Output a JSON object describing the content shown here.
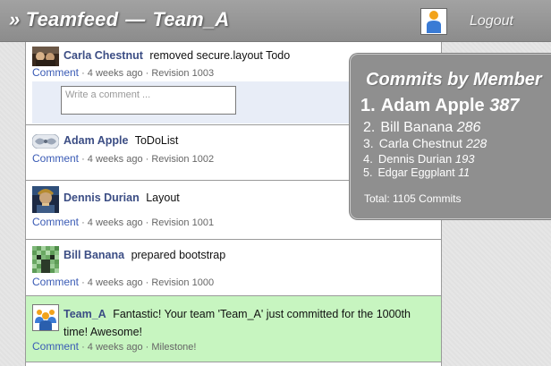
{
  "header": {
    "app_name": "» Teamfeed",
    "separator": "—",
    "team_name": "Team_A",
    "logout_label": "Logout"
  },
  "feed": {
    "comment_label": "Comment",
    "items": [
      {
        "author": "Carla Chestnut",
        "message": "removed secure.layout Todo",
        "time": "· 4 weeks ago",
        "detail": "· Revision 1003",
        "comment_placeholder": "Write a comment ..."
      },
      {
        "author": "Adam Apple",
        "message": "ToDoList",
        "time": "· 4 weeks ago",
        "detail": "· Revision 1002"
      },
      {
        "author": "Dennis Durian",
        "message": "Layout",
        "time": "· 4 weeks ago",
        "detail": "· Revision 1001"
      },
      {
        "author": "Bill Banana",
        "message": "prepared bootstrap",
        "time": "· 4 weeks ago",
        "detail": "· Revision 1000"
      },
      {
        "author": "Team_A",
        "message": "Fantastic! Your team 'Team_A' just committed for the 1000th time! Awesome!",
        "time": "· 4 weeks ago",
        "detail": "· Milestone!"
      }
    ]
  },
  "stats": {
    "title": "Commits by Member",
    "members": [
      {
        "rank": "1.",
        "name": "Adam Apple",
        "commits": "387"
      },
      {
        "rank": "2.",
        "name": "Bill Banana",
        "commits": "286"
      },
      {
        "rank": "3.",
        "name": "Carla Chestnut",
        "commits": "228"
      },
      {
        "rank": "4.",
        "name": "Dennis Durian",
        "commits": "193"
      },
      {
        "rank": "5.",
        "name": "Edgar Eggplant",
        "commits": "11"
      }
    ],
    "total": "Total: 1105 Commits"
  },
  "colors": {
    "header_bg": "#999999",
    "author_link": "#3b4d84",
    "comment_link": "#3a5bb5",
    "milestone_bg": "#c7f5c0",
    "stats_bg": "#8f8f8f"
  },
  "icons": {
    "user_avatar": "user-silhouette-icon",
    "carla_avatar": "carla-chestnut-avatar",
    "adam_avatar": "adam-apple-avatar",
    "dennis_avatar": "dennis-durian-avatar",
    "bill_avatar": "bill-banana-avatar",
    "team_avatar": "team-icon"
  }
}
